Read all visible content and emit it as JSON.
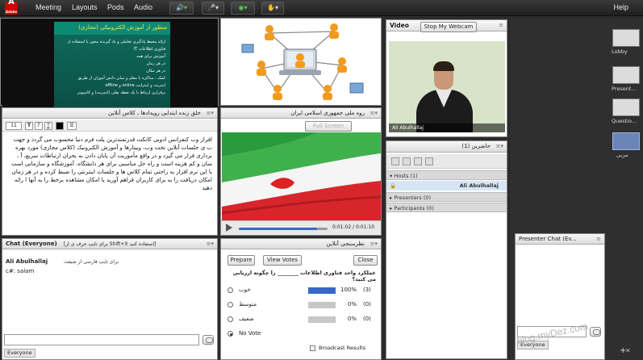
{
  "app": {
    "logo_text": "Adobe"
  },
  "menu": {
    "meeting": "Meeting",
    "layouts": "Layouts",
    "pods": "Pods",
    "audio": "Audio",
    "help": "Help"
  },
  "layouts": {
    "items": [
      "Lobby",
      "Present...",
      "Questio...",
      "مربی"
    ]
  },
  "slide": {
    "heading": "منظور از آموزش الکترونیکی (مجازی)",
    "lines": [
      "ارائه محیط یادگیری تعاملی و یاد گیرنده محور با استفاده از",
      "فناوری اطلاعات IT",
      "آموزش برای همه",
      "در هر زمان",
      "در هر مکان",
      "کمک ، مذاکره با معلم و سایر دانش آموزان از طریق",
      "اینترنت و اینترانت online و offline",
      "برقراری ارتباط با یک نقطه نقلی (اینترنت) و کامپیوتر"
    ]
  },
  "video": {
    "title": "Video",
    "stop_label": "Stop My Webcam",
    "person_name": "Ali Abulhallaj"
  },
  "notes": {
    "title": "خلق زنده ابتدایی رویدادها ، کلاس آنلاین",
    "font_size": "11",
    "text": "افزار وب کنفرانس ادوبی کانکت قدرتمندترین پلت فرم دنیا محسوب می گردد و جهت ب ی جلسات آنلاین تحت وب، وبینارها و آموزش الکترونیک (کلاس مجازی) مورد بهره برداری قرار می گیرد و در واقع مأموریت آن پایان دادن به بحران ارتباطات سریع، آ ، سان و کم هزینه است و راه حل مناسبی برای هر دانشگاه، آموزشگاه و سازمانی است با این نرم افزار به راحتی تمام کلاس ها و جلسات اینترنتی را ضبط کرده و در هر زمان امکان دریافت را به برای کاربران فراهم آورید یا امکان مشاهده برخط را به آنها ا رائه دهید"
  },
  "media": {
    "title": "روه ملی جمهوری اسلامی ایران",
    "fullscreen_label": "Full Screen",
    "time": "0:01:02 / 0:01:10",
    "progress": 0.88
  },
  "attendees": {
    "title": "حاضرین (1)",
    "hosts_label": "Hosts (1)",
    "host_user": "Ali Abulhallaj",
    "presenters_label": "Presenters (0)",
    "participants_label": "Participants (0)"
  },
  "chat": {
    "title": "Chat (Everyone)",
    "hint": "[برای تایپ حرف ی از Shift+X استفاده کنید]",
    "sender": "Ali Abulhallaj",
    "hint2": "برای تایپ فارسی از شیفت",
    "message": "c#: salam",
    "target": "Everyone"
  },
  "poll": {
    "title": "نظرسنجی آنلاین",
    "prepare_label": "Prepare",
    "view_votes_label": "View Votes",
    "close_label": "Close",
    "question": "عملکرد واحد فناوری اطلاعات ________ را چگونه ارزیابی می کنید؟",
    "options": [
      {
        "label": "خوب",
        "pct": "100%",
        "count": "(3)",
        "value": 1.0
      },
      {
        "label": "متوسط",
        "pct": "0%",
        "count": "(0)",
        "value": 0
      },
      {
        "label": "ضعیف",
        "pct": "0%",
        "count": "(0)",
        "value": 0
      },
      {
        "label": "No Vote",
        "pct": "",
        "count": "",
        "value": 0
      }
    ],
    "broadcast_label": "Broadcast Results"
  },
  "presenter_chat": {
    "title": "Presenter Chat (Ev...",
    "target": "Everyone"
  },
  "watermark": "blog.myDez.com"
}
